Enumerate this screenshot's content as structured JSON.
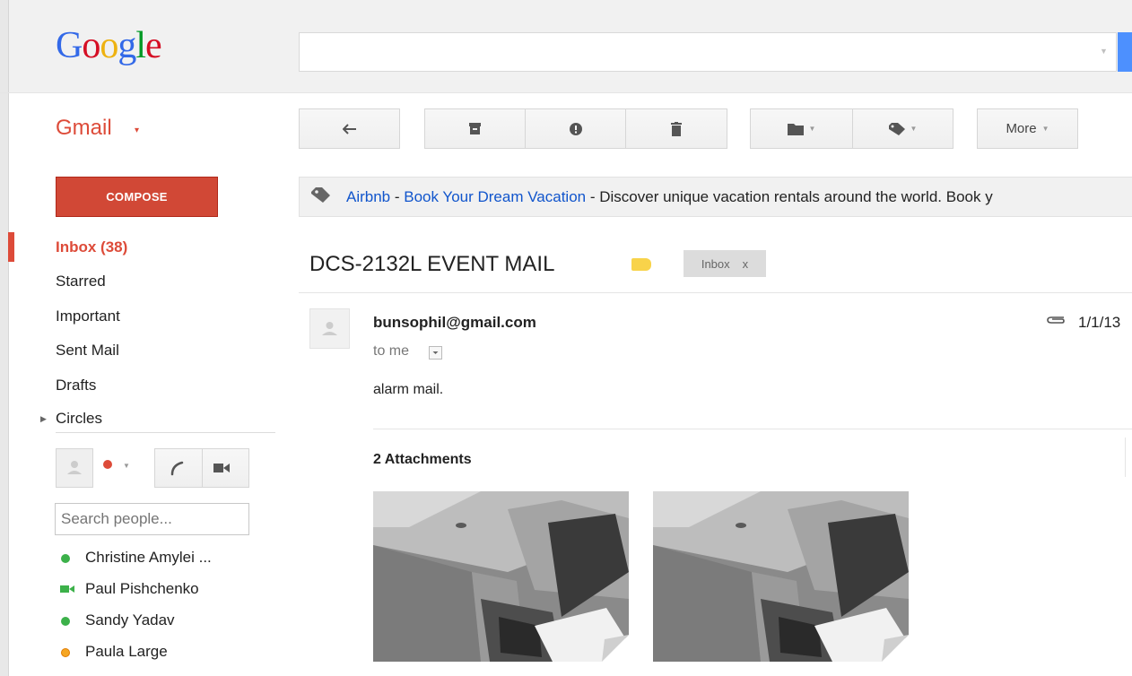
{
  "header": {
    "logo": [
      "G",
      "o",
      "o",
      "g",
      "l",
      "e"
    ],
    "logo_colors": [
      "#3369e8",
      "#d50f25",
      "#eeb211",
      "#3369e8",
      "#009925",
      "#d50f25"
    ],
    "search_placeholder": ""
  },
  "app": {
    "name": "Gmail",
    "caret": "▾"
  },
  "toolbar": {
    "more_label": "More"
  },
  "compose_label": "COMPOSE",
  "ad": {
    "brand": "Airbnb",
    "sep1": " - ",
    "headline": "Book Your Dream Vacation",
    "sep2": " - ",
    "text": "Discover unique vacation rentals around the world. Book y"
  },
  "nav": {
    "inbox": "Inbox (38)",
    "starred": "Starred",
    "important": "Important",
    "sent": "Sent Mail",
    "drafts": "Drafts",
    "circles": "Circles"
  },
  "chat": {
    "search_placeholder": "Search people...",
    "contacts": [
      {
        "name": "Christine Amylei ...",
        "status": "available",
        "color": "#3cb14a"
      },
      {
        "name": "Paul Pishchenko",
        "status": "video",
        "color": "#3cb14a"
      },
      {
        "name": "Sandy Yadav",
        "status": "available",
        "color": "#3cb14a"
      },
      {
        "name": "Paula Large",
        "status": "idle",
        "color": "#f5a623"
      }
    ]
  },
  "message": {
    "subject": "DCS-2132L EVENT MAIL",
    "label_chip": "Inbox",
    "label_chip_close": "x",
    "sender": "bunsophil@gmail.com",
    "to": "to me",
    "date": "1/1/13",
    "body": "alarm mail.",
    "attachments_title": "2 Attachments"
  }
}
